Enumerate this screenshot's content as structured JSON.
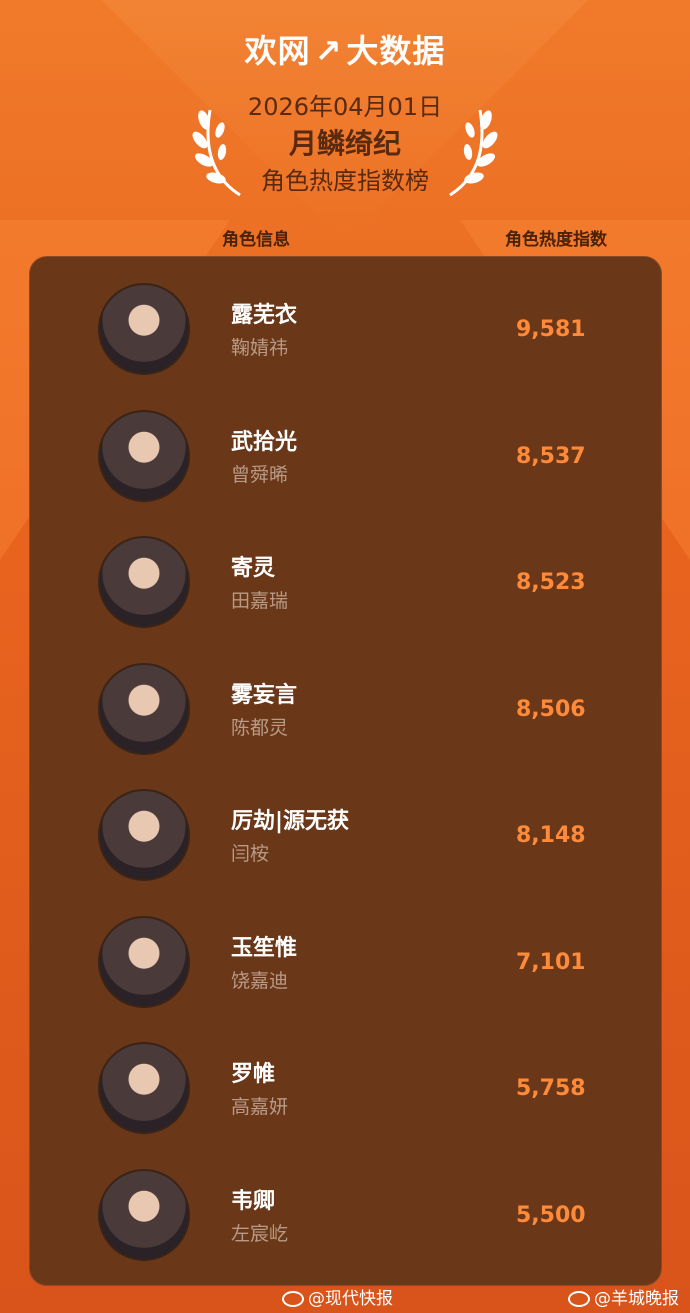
{
  "logo": {
    "left": "欢网",
    "right": "大数据"
  },
  "header": {
    "date": "2026年04月01日",
    "show_title": "月鳞绮纪",
    "subtitle": "角色热度指数榜"
  },
  "columns": {
    "info": "角色信息",
    "index": "角色热度指数"
  },
  "rows": [
    {
      "name": "露芜衣",
      "actor": "鞠婧祎",
      "score": "9,581"
    },
    {
      "name": "武拾光",
      "actor": "曾舜晞",
      "score": "8,537"
    },
    {
      "name": "寄灵",
      "actor": "田嘉瑞",
      "score": "8,523"
    },
    {
      "name": "雾妄言",
      "actor": "陈都灵",
      "score": "8,506"
    },
    {
      "name": "厉劫|源无获",
      "actor": "闫桉",
      "score": "8,148"
    },
    {
      "name": "玉笙惟",
      "actor": "饶嘉迪",
      "score": "7,101"
    },
    {
      "name": "罗帷",
      "actor": "高嘉妍",
      "score": "5,758"
    },
    {
      "name": "韦卿",
      "actor": "左宸屹",
      "score": "5,500"
    }
  ],
  "footer": {
    "left": "@现代快报",
    "right": "@羊城晚报"
  }
}
